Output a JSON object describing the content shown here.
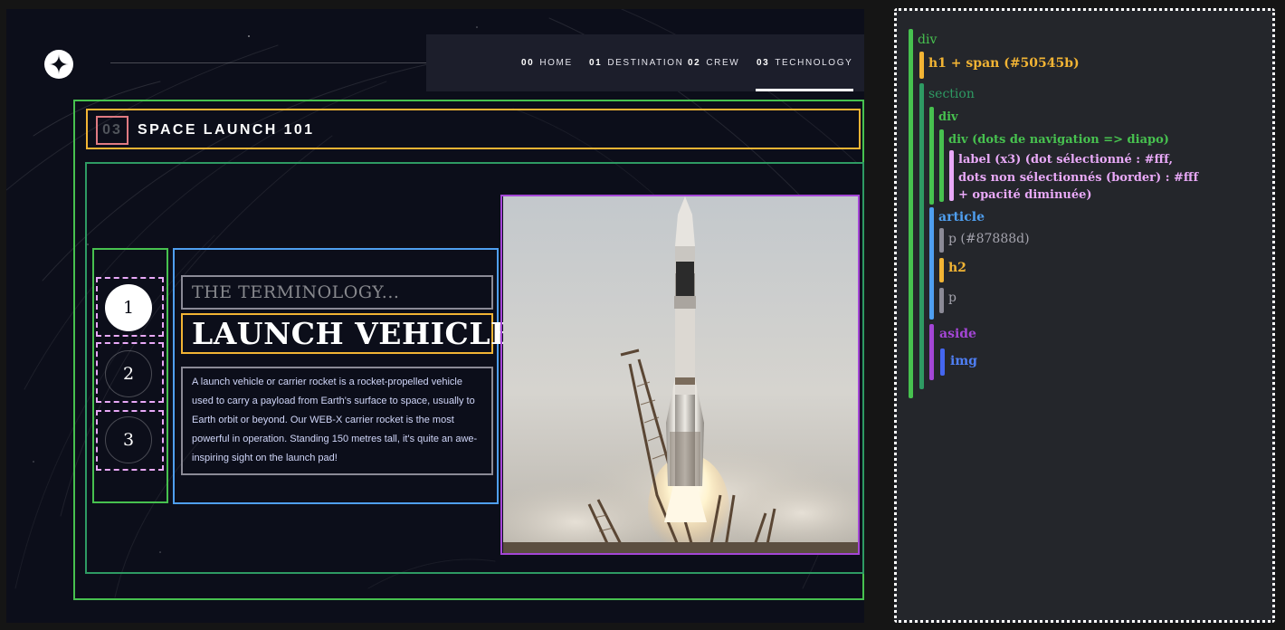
{
  "nav": {
    "items": [
      {
        "num": "00",
        "label": "HOME"
      },
      {
        "num": "01",
        "label": "DESTINATION"
      },
      {
        "num": "02",
        "label": "CREW"
      },
      {
        "num": "03",
        "label": "TECHNOLOGY"
      }
    ],
    "active_index": 3
  },
  "page": {
    "number": "03",
    "title": "SPACE LAUNCH 101"
  },
  "slider": {
    "dots": [
      "1",
      "2",
      "3"
    ],
    "selected_index": 0
  },
  "article": {
    "eyebrow": "THE TERMINOLOGY...",
    "heading": "LAUNCH VEHICLE",
    "body": "A launch vehicle or carrier rocket is a rocket-propelled vehicle used to carry a payload from Earth's surface to space, usually to Earth orbit or beyond. Our WEB-X carrier rocket is the most powerful in operation. Standing 150 metres tall, it's quite an awe-inspiring sight on the launch pad!"
  },
  "annotations": {
    "div": "div",
    "h1": "h1 + span (#50545b)",
    "section": "section",
    "inner_div": "div",
    "dots_div": "div (dots de navigation => diapo)",
    "label_line1": "label (x3) (dot sélectionné : #fff,",
    "label_line2": "dots non sélectionnés (border) : #fff",
    "label_line3": "+ opacité diminuée)",
    "article": "article",
    "p1": "p (#87888d)",
    "h2": "h2",
    "p2": "p",
    "aside": "aside",
    "img": "img"
  },
  "colors": {
    "green": "#47c14f",
    "dark_green": "#2e9a63",
    "orange": "#f2b434",
    "blue": "#4f9ff0",
    "purple": "#a446d6",
    "grey": "#8b8a96",
    "pink": "#e9a9f8",
    "span_grey": "#50545b"
  }
}
